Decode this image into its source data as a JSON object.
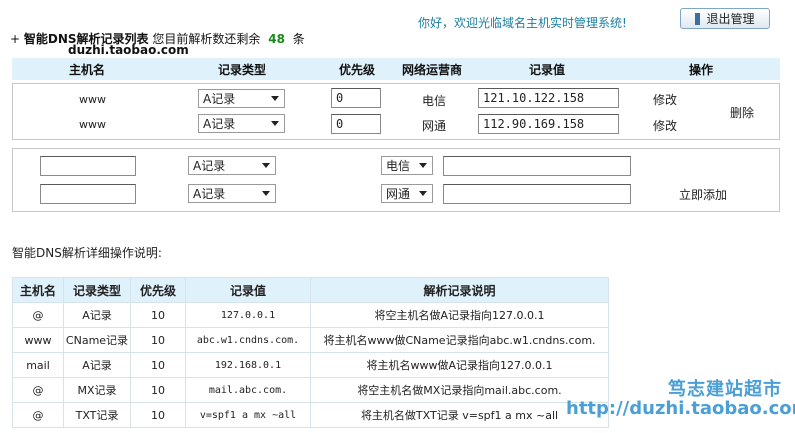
{
  "header": {
    "bullet": "+",
    "title": "智能DNS解析记录列表",
    "remain_prefix": "您目前解析数还剩余",
    "remain_count": "48",
    "remain_suffix": "条",
    "watermark_top": "duzhi.taobao.com",
    "welcome": "你好，欢迎光临域名主机实时管理系统!",
    "logout_label": "退出管理"
  },
  "records": {
    "columns": [
      "主机名",
      "记录类型",
      "优先级",
      "网络运营商",
      "记录值",
      "操作"
    ],
    "rows": [
      {
        "host": "www",
        "type": "A记录",
        "priority": "0",
        "isp": "电信",
        "value": "121.10.122.158",
        "edit": "修改"
      },
      {
        "host": "www",
        "type": "A记录",
        "priority": "0",
        "isp": "网通",
        "value": "112.90.169.158",
        "edit": "修改"
      }
    ],
    "delete_label": "删除"
  },
  "add": {
    "rows": [
      {
        "host": "",
        "type": "A记录",
        "isp": "电信",
        "value": ""
      },
      {
        "host": "",
        "type": "A记录",
        "isp": "网通",
        "value": ""
      }
    ],
    "submit_label": "立即添加"
  },
  "guide": {
    "title": "智能DNS解析详细操作说明:",
    "columns": [
      "主机名",
      "记录类型",
      "优先级",
      "记录值",
      "解析记录说明"
    ],
    "rows": [
      [
        "@",
        "A记录",
        "10",
        "127.0.0.1",
        "将空主机名做A记录指向127.0.0.1"
      ],
      [
        "www",
        "CName记录",
        "10",
        "abc.w1.cndns.com.",
        "将主机名www做CName记录指向abc.w1.cndns.com."
      ],
      [
        "mail",
        "A记录",
        "10",
        "192.168.0.1",
        "将主机名www做A记录指向127.0.0.1"
      ],
      [
        "@",
        "MX记录",
        "10",
        "mail.abc.com.",
        "将空主机名做MX记录指向mail.abc.com."
      ],
      [
        "@",
        "TXT记录",
        "10",
        "v=spf1 a mx ~all",
        "将主机名做TXT记录 v=spf1 a mx ~all"
      ]
    ]
  },
  "watermark": {
    "shop_name": "笃志建站超市",
    "url": "http://duzhi.taobao.com"
  }
}
